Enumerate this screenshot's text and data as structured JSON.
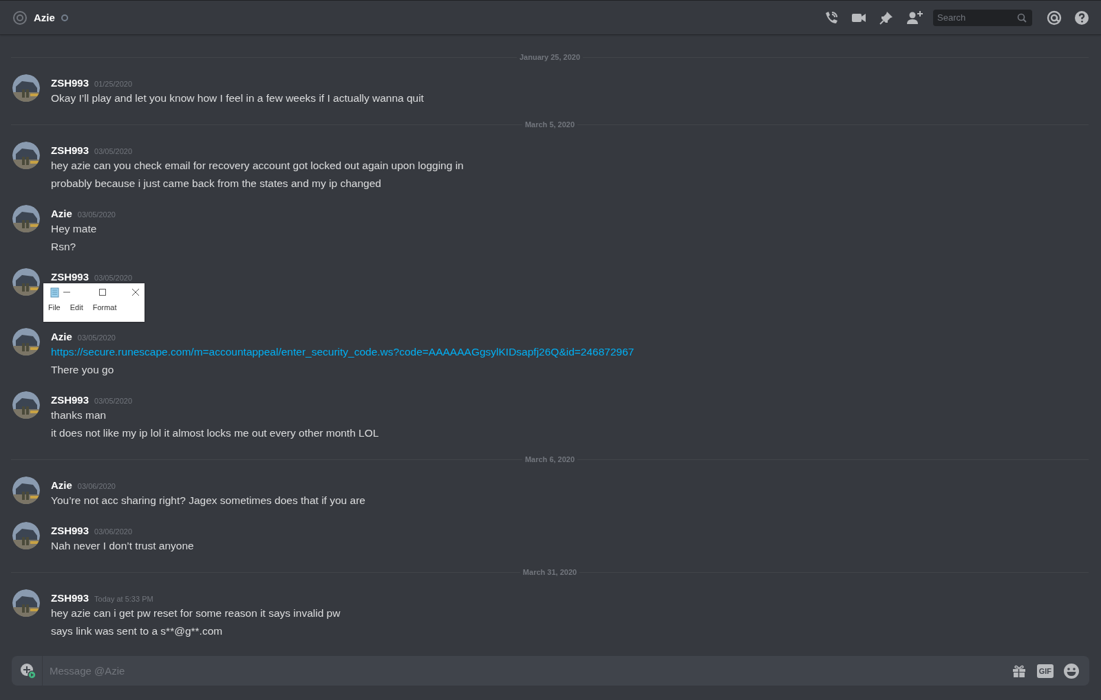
{
  "header": {
    "title": "Azie",
    "online": false,
    "search": {
      "placeholder": "Search"
    }
  },
  "items": [
    {
      "kind": "divider",
      "label": "January 25, 2020"
    },
    {
      "kind": "message",
      "author": "ZSH993",
      "time": "01/25/2020",
      "lines": [
        {
          "text": "Okay I’ll play and let you know how I feel in a few weeks if I actually wanna quit"
        }
      ]
    },
    {
      "kind": "divider",
      "label": "March 5, 2020"
    },
    {
      "kind": "message",
      "author": "ZSH993",
      "time": "03/05/2020",
      "lines": [
        {
          "text": "hey azie can you check email for recovery account got locked out again upon logging in"
        },
        {
          "text": "probably because i just came back from the states and my ip changed"
        }
      ]
    },
    {
      "kind": "message",
      "author": "Azie",
      "time": "03/05/2020",
      "lines": [
        {
          "text": "Hey mate"
        },
        {
          "text": "Rsn?"
        }
      ]
    },
    {
      "kind": "message",
      "author": "ZSH993",
      "time": "03/05/2020",
      "overlay": {
        "kind": "notepad",
        "menus": [
          "File",
          "Edit",
          "Format"
        ]
      }
    },
    {
      "kind": "message",
      "author": "Azie",
      "time": "03/05/2020",
      "lines": [
        {
          "text": "https://secure.runescape.com/m=accountappeal/enter_security_code.ws?code=AAAAAAGgsylKIDsapfj26Q&id=246872967",
          "link": true
        },
        {
          "text": "There you go"
        }
      ]
    },
    {
      "kind": "message",
      "author": "ZSH993",
      "time": "03/05/2020",
      "lines": [
        {
          "text": "thanks man"
        },
        {
          "text": "it does not like my ip lol it almost locks me out every other month LOL"
        }
      ]
    },
    {
      "kind": "divider",
      "label": "March 6, 2020"
    },
    {
      "kind": "message",
      "author": "Azie",
      "time": "03/06/2020",
      "lines": [
        {
          "text": "You’re not acc sharing right? Jagex sometimes does that if you are"
        }
      ]
    },
    {
      "kind": "message",
      "author": "ZSH993",
      "time": "03/06/2020",
      "lines": [
        {
          "text": "Nah never I don’t trust anyone"
        }
      ]
    },
    {
      "kind": "divider",
      "label": "March 31, 2020"
    },
    {
      "kind": "message",
      "author": "ZSH993",
      "time": "Today at 5:33 PM",
      "lines": [
        {
          "text": "hey azie can i get pw reset for some reason it says invalid pw"
        },
        {
          "text": "says link was sent to a  s**@g**.com"
        }
      ]
    }
  ],
  "composer": {
    "placeholder": "Message @Azie",
    "gif_label": "GIF"
  }
}
